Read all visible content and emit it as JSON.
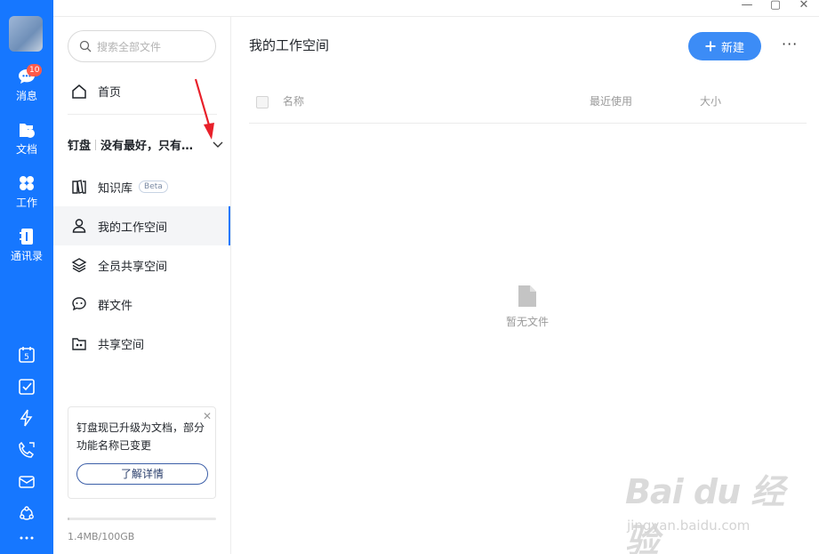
{
  "window": {
    "controls": [
      "—",
      "▢",
      "✕"
    ]
  },
  "rail": {
    "badge": "10",
    "items": [
      {
        "label": "消息",
        "icon": "chat-bubble-icon"
      },
      {
        "label": "文档",
        "icon": "folder-cloud-icon"
      },
      {
        "label": "工作",
        "icon": "grid-flower-icon"
      },
      {
        "label": "通讯录",
        "icon": "contact-book-icon"
      }
    ],
    "bottom_icons": [
      "calendar-icon",
      "checkbox-icon",
      "lightning-icon",
      "phone-icon",
      "mail-icon",
      "network-icon",
      "more-dots-icon"
    ],
    "calendar_day": "5"
  },
  "sidebar": {
    "search_placeholder": "搜索全部文件",
    "home_label": "首页",
    "space_brand": "钉盘",
    "space_name": "没有最好，只有…",
    "items": [
      {
        "label": "知识库",
        "badge": "Beta",
        "icon": "book-icon"
      },
      {
        "label": "我的工作空间",
        "icon": "person-icon",
        "active": true
      },
      {
        "label": "全员共享空间",
        "icon": "layers-icon"
      },
      {
        "label": "群文件",
        "icon": "group-chat-icon"
      },
      {
        "label": "共享空间",
        "icon": "shared-folder-icon"
      }
    ],
    "notice": {
      "text": "钉盘现已升级为文档，部分功能名称已变更",
      "button": "了解详情",
      "close": "✕"
    },
    "storage": {
      "text": "1.4MB/100GB",
      "used_fraction": 0.0
    }
  },
  "main": {
    "title": "我的工作空间",
    "new_button": "新建",
    "more": "···",
    "columns": [
      "名称",
      "最近使用",
      "大小"
    ],
    "empty_text": "暂无文件"
  },
  "watermark": {
    "logo": "Bai du 经验",
    "url": "jingyan.baidu.com"
  },
  "colors": {
    "accent": "#1677ff",
    "button": "#3c8cf6",
    "badge": "#ff5a4a",
    "annotation": "#e8202a"
  }
}
